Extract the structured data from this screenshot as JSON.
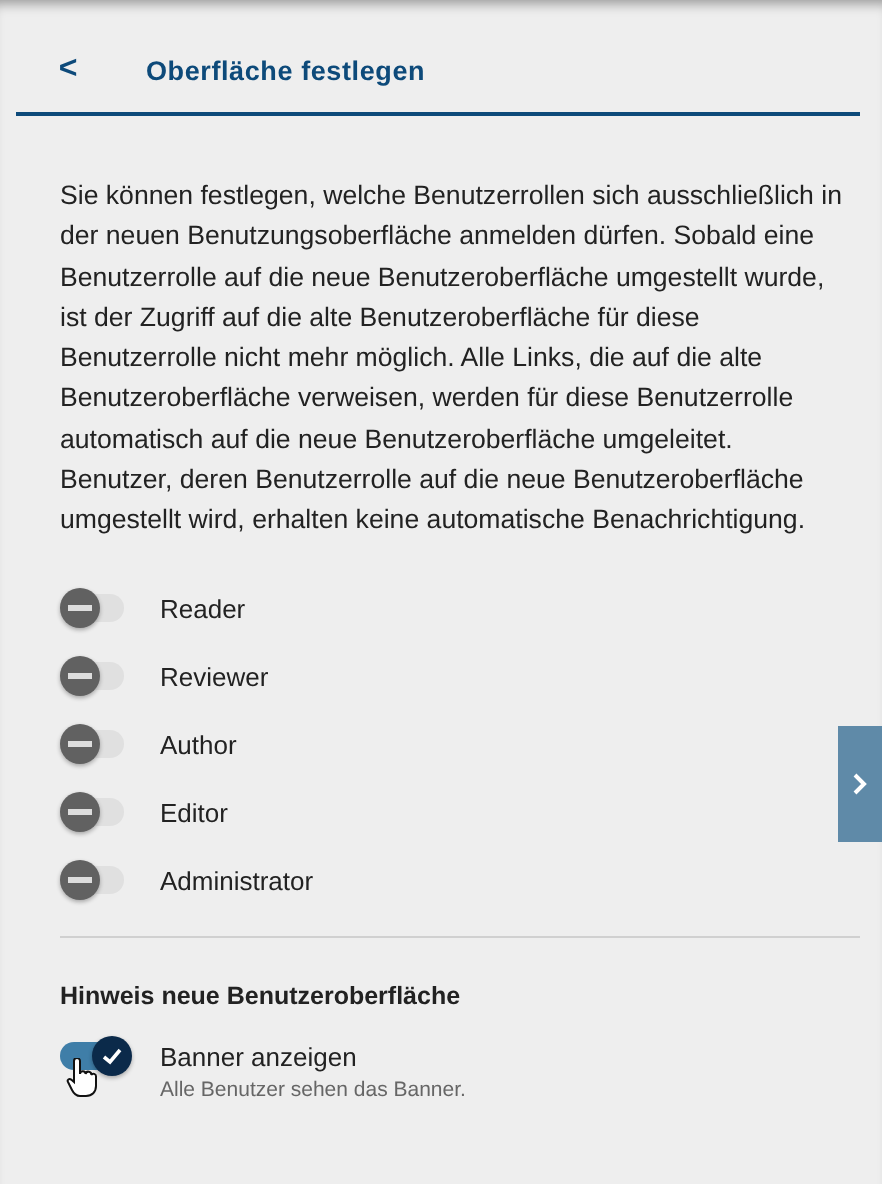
{
  "header": {
    "back": "<",
    "title": "Oberfläche festlegen"
  },
  "description": "Sie können festlegen, welche Benutzerrollen sich ausschließlich in der neuen Benutzungsoberfläche anmelden dürfen. Sobald eine Benutzerrolle auf die neue Benutzeroberfläche umgestellt wurde, ist der Zugriff auf die alte Benutzeroberfläche für diese Benutzerrolle nicht mehr möglich. Alle Links, die auf die alte Benutzeroberfläche verweisen, werden für diese Benutzerrolle automatisch auf die neue Benutzeroberfläche umgeleitet. Benutzer, deren Benutzerrolle auf die neue Benutzeroberfläche umgestellt wird, erhalten keine automatische Benachrichtigung.",
  "roles": [
    {
      "label": "Reader",
      "on": false
    },
    {
      "label": "Reviewer",
      "on": false
    },
    {
      "label": "Author",
      "on": false
    },
    {
      "label": "Editor",
      "on": false
    },
    {
      "label": "Administrator",
      "on": false
    }
  ],
  "notice": {
    "heading": "Hinweis neue Benutzeroberfläche",
    "label": "Banner anzeigen",
    "hint": "Alle Benutzer sehen das Banner.",
    "on": true
  }
}
